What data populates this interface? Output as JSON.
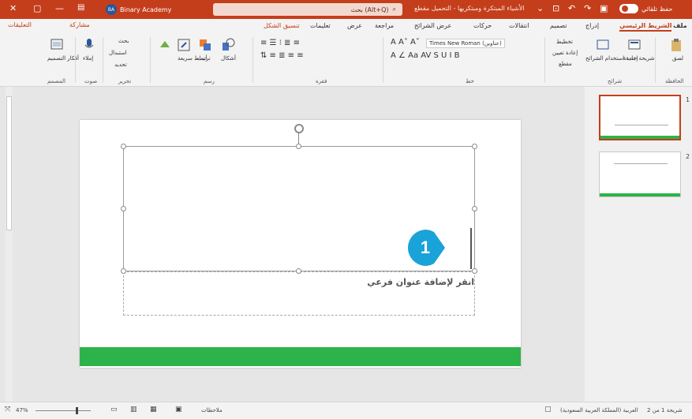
{
  "titlebar": {
    "account": "Binary Academy",
    "account_initials": "BA",
    "search_placeholder": "بحث (Alt+Q)",
    "doc_title": "الأشياء المبتكرة ومبتكريها - التحميل مقطع",
    "autosave_label": "حفظ تلقائي"
  },
  "tabs": {
    "file": "ملف",
    "home": "الشريط الرئيسي",
    "insert": "إدراج",
    "design": "تصميم",
    "transitions": "انتقالات",
    "animations": "حركات",
    "slideshow": "عرض الشرائح",
    "review": "مراجعة",
    "view": "عرض",
    "help": "تعليمات",
    "shape_format": "تنسيق الشكل",
    "share": "مشاركة",
    "comments": "التعليقات"
  },
  "ribbon": {
    "clipboard": "الحافظة",
    "paste": "لصق",
    "slides": "شرائح",
    "new_slide": "شريحة جديدة",
    "reuse_slides": "إعادة استخدام الشرائح",
    "layout": "تخطيط",
    "reset": "إعادة تعيين",
    "section": "مقطع",
    "font": "خط",
    "font_name": "Times New Roman (عناوين)",
    "paragraph": "فقرة",
    "drawing": "رسم",
    "shapes": "أشكال",
    "arrange": "ترتيب",
    "quick_styles": "أنماط سريعة",
    "editing": "تحرير",
    "find": "بحث",
    "replace": "استبدال",
    "select": "تحديد",
    "voice": "صوت",
    "dictate": "إملاء",
    "designer": "المصمم",
    "design_ideas": "أفكار التصميم"
  },
  "slide": {
    "subtitle_placeholder": "انقر لإضافة عنوان فرعي",
    "callout_number": "1"
  },
  "thumbnails": {
    "slide1": "1",
    "slide2": "2"
  },
  "status": {
    "slide_count": "شريحة 1 من 2",
    "language": "العربية (المملكة العربية السعودية)",
    "notes": "ملاحظات",
    "zoom": "47%"
  },
  "colors": {
    "accent": "#c43e1c",
    "green": "#2db34a",
    "callout": "#1aa3d8"
  }
}
